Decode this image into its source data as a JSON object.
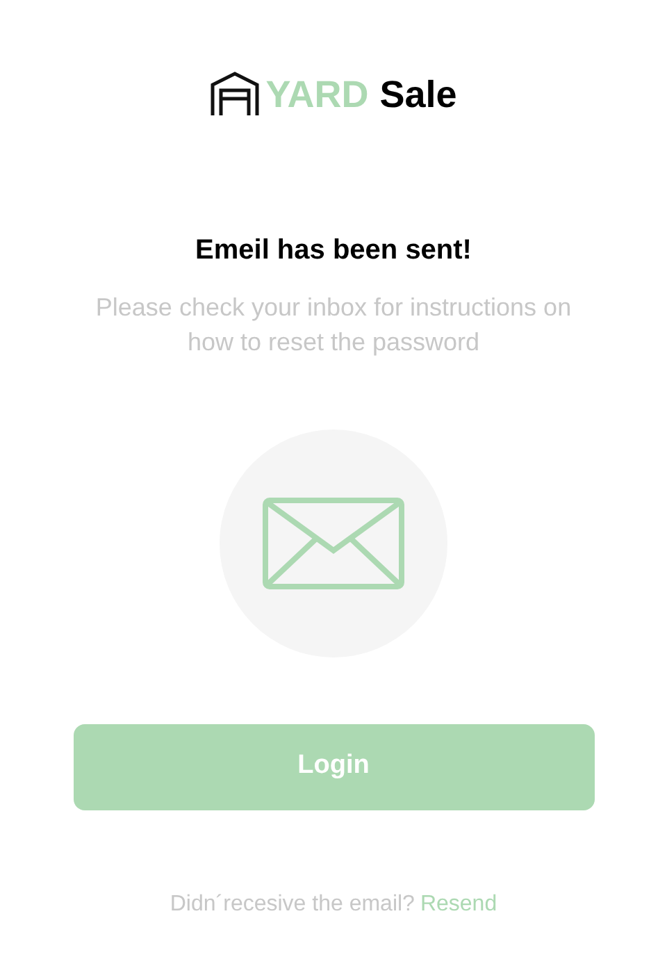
{
  "logo": {
    "part_1": "YARD",
    "part_2": "Sale"
  },
  "title": "Emeil has been sent!",
  "subtitle": "Please check your inbox for instructions on how to reset the password",
  "button": "Login",
  "footer": {
    "text": "Didn´recesive the email?",
    "link": "Resend"
  }
}
